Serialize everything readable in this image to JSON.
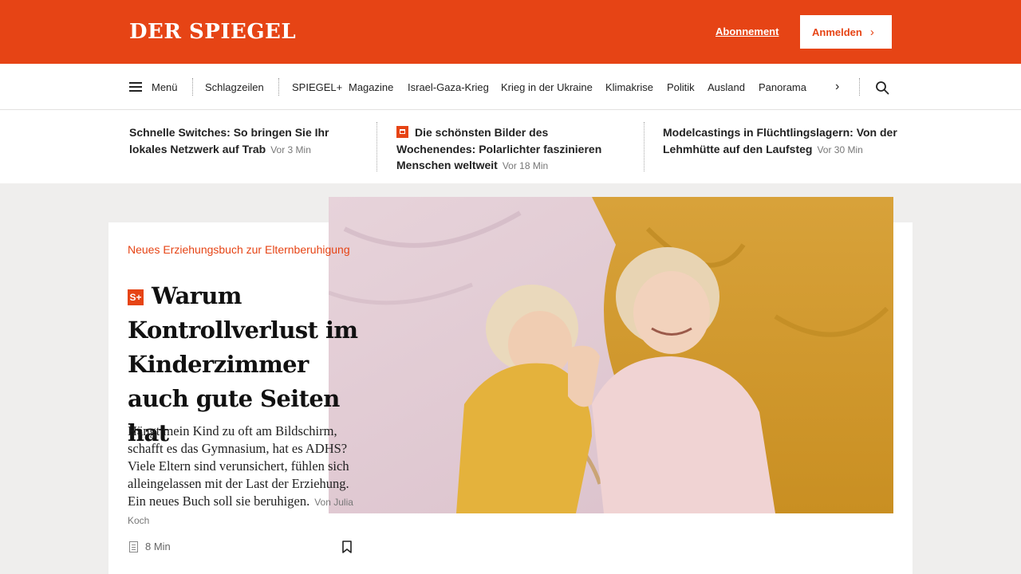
{
  "header": {
    "logo": "DER SPIEGEL",
    "abo_label": "Abonnement",
    "login_label": "Anmelden",
    "login_icon": "chevron-right-icon",
    "brand_color": "#e64415"
  },
  "nav": {
    "menu_label": "Menü",
    "items": [
      "Schlagzeilen",
      "SPIEGEL+",
      "Magazine",
      "Israel-Gaza-Krieg",
      "Krieg in der Ukraine",
      "Klimakrise",
      "Politik",
      "Ausland",
      "Panorama"
    ],
    "more_icon": "chevron-right-icon",
    "search_icon": "search-icon"
  },
  "teasers": [
    {
      "title": "Schnelle Switches: So bringen Sie Ihr lokales Netzwerk auf Trab",
      "time": "Vor 3 Min",
      "icon": ""
    },
    {
      "title": "Die schönsten Bilder des Wochenendes: Polarlichter faszinieren Menschen weltweit",
      "time": "Vor 18 Min",
      "icon": "gallery-icon"
    },
    {
      "title": "Modelcastings in Flüchtlingslagern: Von der Lehmhütte auf den Laufsteg",
      "time": "Vor 30 Min",
      "icon": ""
    }
  ],
  "main": {
    "kicker": "Neues Erziehungsbuch zur Elternberuhigung",
    "badge": "S+",
    "headline": "Warum Kontrollverlust im Kinderzimmer auch gute Seiten hat",
    "teaser": "Hängt mein Kind zu oft am Bildschirm, schafft es das Gymnasium, hat es ADHS? Viele Eltern sind verunsichert, fühlen sich alleingelassen mit der Last der Erziehung. Ein neues Buch soll sie beruhigen.",
    "author": "Von Julia Koch",
    "reading_time": "8 Min",
    "bookmark_icon": "bookmark-icon"
  }
}
